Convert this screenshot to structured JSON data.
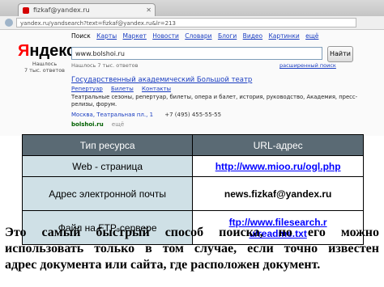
{
  "browser": {
    "tab_title": "fizkaf@yandex.ru",
    "address": "yandex.ru/yandsearch?text=fizkaf@yandex.ru&lr=213"
  },
  "yandex": {
    "logo_first_letter": "Я",
    "logo_rest": "ндекс",
    "sub_line1": "Нашлось",
    "sub_line2": "7 тыс. ответов",
    "nav_items": [
      {
        "label": "Поиск",
        "active": true
      },
      {
        "label": "Карты",
        "active": false
      },
      {
        "label": "Маркет",
        "active": false
      },
      {
        "label": "Новости",
        "active": false
      },
      {
        "label": "Словари",
        "active": false
      },
      {
        "label": "Блоги",
        "active": false
      },
      {
        "label": "Видео",
        "active": false
      },
      {
        "label": "Картинки",
        "active": false
      },
      {
        "label": "ещё",
        "active": false
      }
    ],
    "search_value": "www.bolshoi.ru",
    "search_button": "Найти",
    "found_text": "Нашлось 7 тыс. ответов",
    "advanced_link": "расширенный поиск",
    "result": {
      "title": "Государственный академический Большой театр",
      "links": [
        "Репертуар",
        "Билеты",
        "Контакты"
      ],
      "snippet": "Театральные сезоны, репертуар, билеты, опера и балет, история, руководство, Академия, пресс-релизы, форум.",
      "address": "Москва, Театральная пл., 1",
      "phone": "+7 (495) 455-55-55",
      "url": "bolshoi.ru",
      "more": "ещё"
    }
  },
  "table": {
    "headers": [
      "Тип ресурса",
      "URL-адрес"
    ],
    "rows": [
      {
        "type": "Web - страница",
        "value": "http://www.mioo.ru/ogl.php"
      },
      {
        "type": "Адрес электронной почты",
        "value": "news.fizkaf@yandex.ru"
      },
      {
        "type": "Файл на FTP-сервере",
        "value_line1": "ftp://www.filesearch.r",
        "value_line2": "u/readme.txt"
      }
    ]
  },
  "caption": {
    "line1": "Это самый быстрый способ поиска, но его можно",
    "line2": "использовать только в том случае, если точно известен",
    "line3": "адрес документа или сайта, где расположен документ."
  }
}
